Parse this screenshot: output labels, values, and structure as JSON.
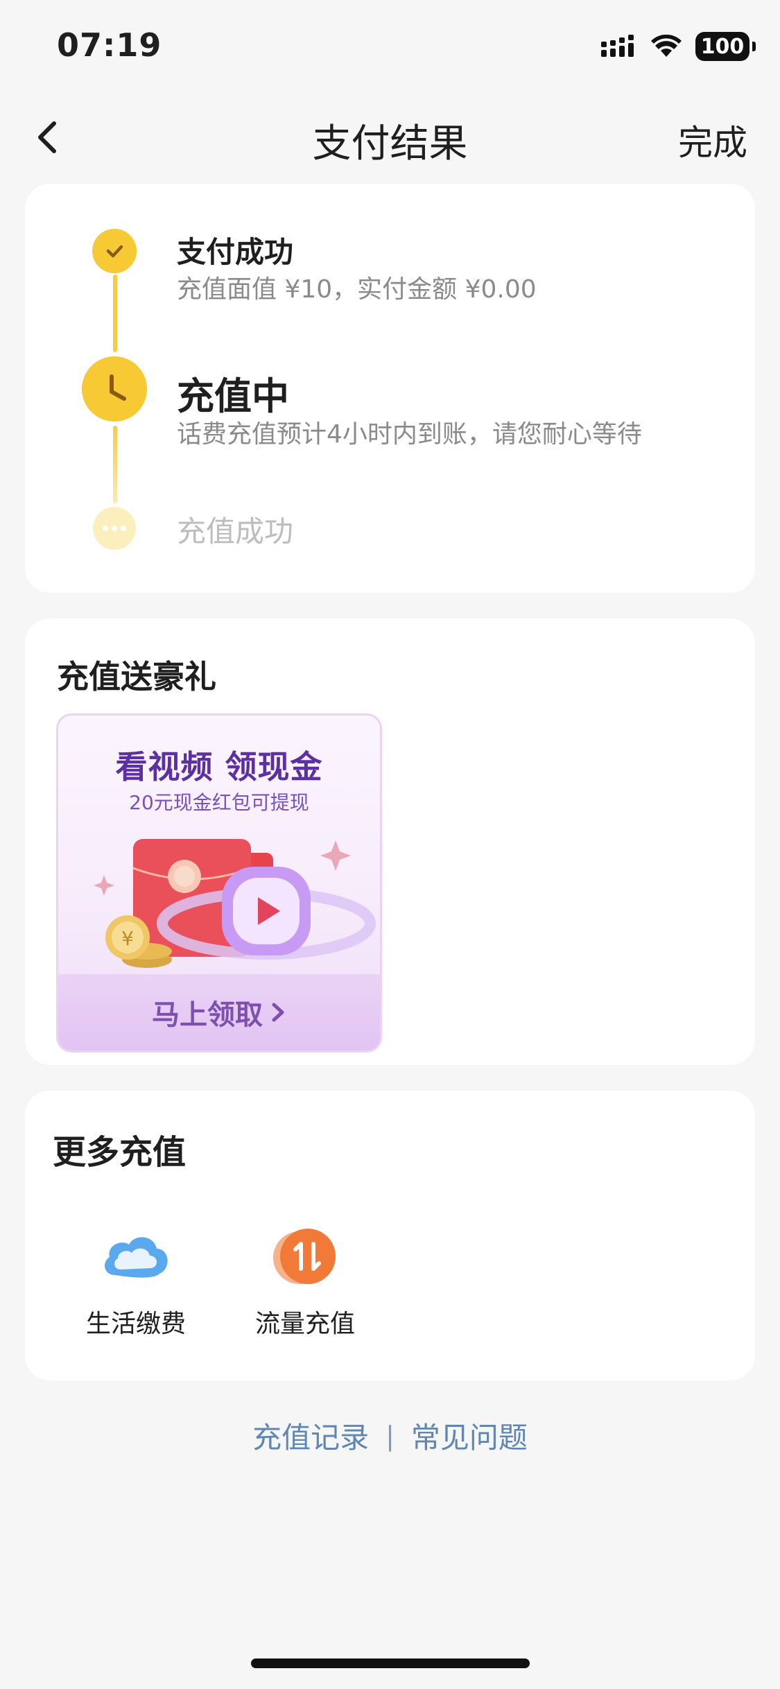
{
  "status_bar": {
    "time": "07:19",
    "battery": "100"
  },
  "nav": {
    "title": "支付结果",
    "done_label": "完成"
  },
  "timeline": {
    "steps": [
      {
        "title": "支付成功",
        "subtitle": "充值面值 ¥10，实付金额 ¥0.00",
        "state": "done"
      },
      {
        "title": "充值中",
        "subtitle": "话费充值预计4小时内到账，请您耐心等待",
        "state": "current"
      },
      {
        "title": "充值成功",
        "state": "pending"
      }
    ]
  },
  "gift": {
    "heading": "充值送豪礼",
    "banner": {
      "title": "看视频 领现金",
      "subtitle": "20元现金红包可提现",
      "cta": "马上领取"
    }
  },
  "more": {
    "heading": "更多充值",
    "items": [
      {
        "label": "生活缴费",
        "icon": "cloud-icon"
      },
      {
        "label": "流量充值",
        "icon": "data-transfer-icon"
      }
    ]
  },
  "footer_links": {
    "records": "充值记录",
    "separator": "|",
    "faq": "常见问题"
  },
  "colors": {
    "accent_yellow": "#f6c935",
    "link_blue": "#5f87b3",
    "banner_purple": "#5c2fa3"
  }
}
